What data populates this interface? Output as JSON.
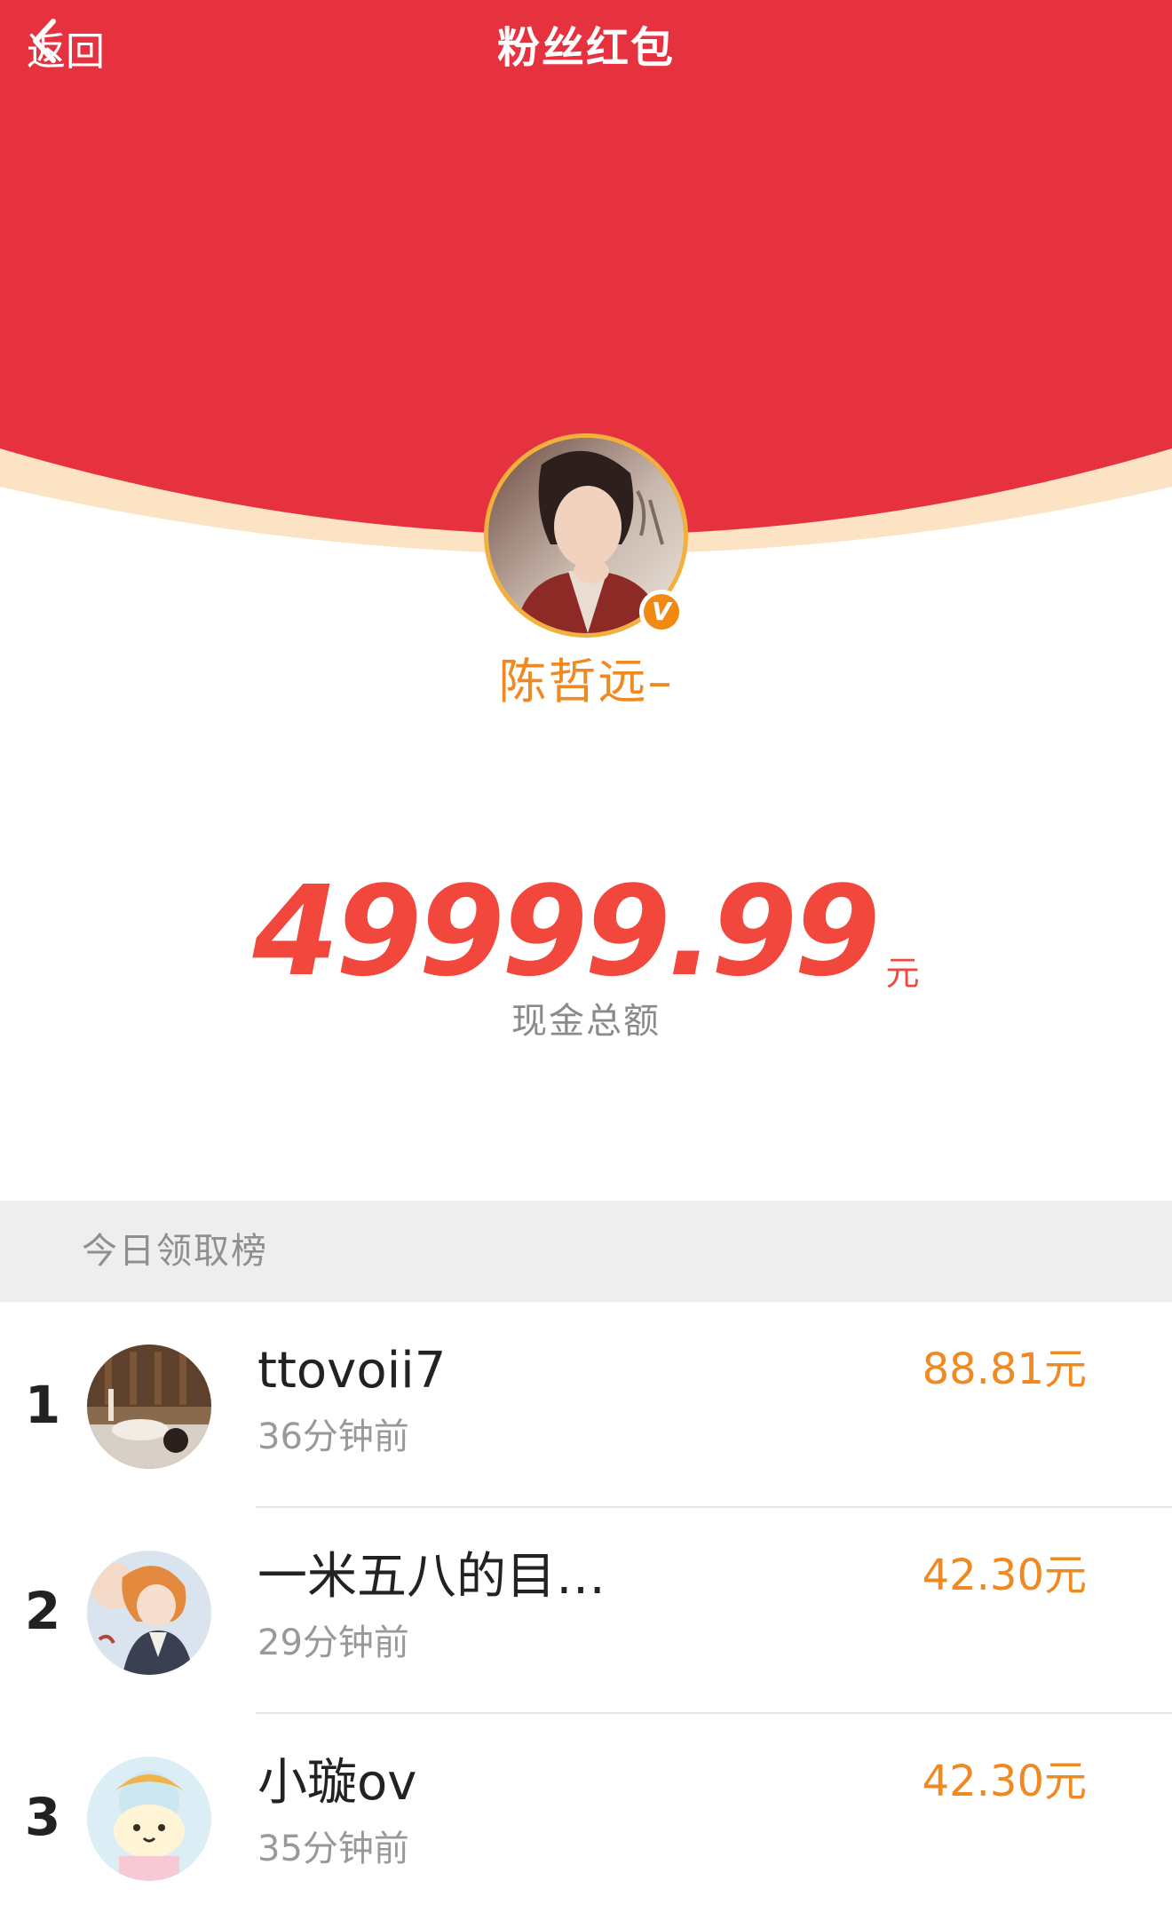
{
  "nav": {
    "back_label": "返回",
    "title": "粉丝红包"
  },
  "host": {
    "name": "陈哲远–",
    "badge": "V"
  },
  "amount": {
    "value": "49999.99",
    "unit": "元",
    "label": "现金总额"
  },
  "ranking": {
    "title": "今日领取榜",
    "rows": [
      {
        "rank": "1",
        "name": "ttovoii7",
        "time": "36分钟前",
        "amount": "88.81元"
      },
      {
        "rank": "2",
        "name": "一米五八的目…",
        "time": "29分钟前",
        "amount": "42.30元"
      },
      {
        "rank": "3",
        "name": "小璇ov",
        "time": "35分钟前",
        "amount": "42.30元"
      }
    ]
  },
  "colors": {
    "header_red": "#e6323e",
    "envelope_edge": "#fbe3c4",
    "amount_red": "#f2473d",
    "accent_orange": "#ef8a22",
    "section_bg": "#eeeeee"
  }
}
